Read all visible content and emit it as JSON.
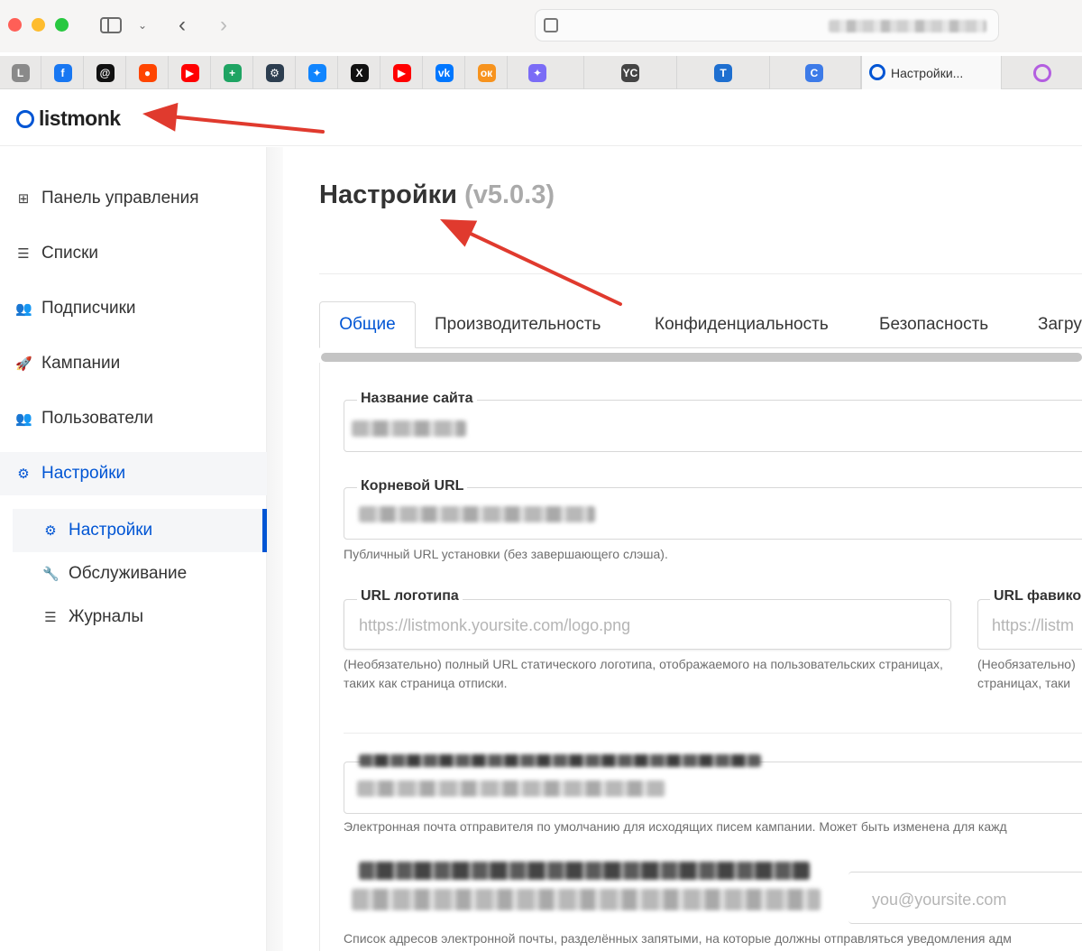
{
  "browser": {
    "active_tab_title": "Настройки...",
    "pinned_tabs": [
      {
        "icon": "l-icon",
        "glyph": "L",
        "color": "#8a8a8a"
      },
      {
        "icon": "facebook-icon",
        "glyph": "f",
        "color": "#1877f2"
      },
      {
        "icon": "threads-icon",
        "glyph": "@",
        "color": "#111111"
      },
      {
        "icon": "reddit-icon",
        "glyph": "●",
        "color": "#ff4500"
      },
      {
        "icon": "youtube-icon",
        "glyph": "▶",
        "color": "#ff0000"
      },
      {
        "icon": "sheets-icon",
        "glyph": "+",
        "color": "#1fa463"
      },
      {
        "icon": "gear-icon",
        "glyph": "⚙",
        "color": "#2d3e50"
      },
      {
        "icon": "bluesky-icon",
        "glyph": "✦",
        "color": "#1185fe"
      },
      {
        "icon": "x-icon",
        "glyph": "X",
        "color": "#111111"
      },
      {
        "icon": "youtube-icon",
        "glyph": "▶",
        "color": "#ff0000"
      },
      {
        "icon": "vk-icon",
        "glyph": "vk",
        "color": "#0077ff"
      },
      {
        "icon": "odnoklassniki-icon",
        "glyph": "ок",
        "color": "#f7931e"
      }
    ],
    "wide_tabs": [
      {
        "icon": "gemini-icon",
        "glyph": "✦",
        "color": "#7b6cf6"
      },
      {
        "icon": "yc-icon",
        "glyph": "YC",
        "color": "#444444"
      },
      {
        "icon": "t-icon",
        "glyph": "T",
        "color": "#1e6fd0"
      },
      {
        "icon": "c-icon",
        "glyph": "C",
        "color": "#3d7be8"
      }
    ]
  },
  "app": {
    "brand": "listmonk",
    "accent_color": "#0055d4"
  },
  "sidebar": {
    "items": [
      {
        "label": "Панель управления",
        "icon": "dashboard-icon"
      },
      {
        "label": "Списки",
        "icon": "list-icon"
      },
      {
        "label": "Подписчики",
        "icon": "users-icon"
      },
      {
        "label": "Кампании",
        "icon": "rocket-icon"
      },
      {
        "label": "Пользователи",
        "icon": "users-icon"
      },
      {
        "label": "Настройки",
        "icon": "gear-icon",
        "active": true
      }
    ],
    "subitems": [
      {
        "label": "Настройки",
        "icon": "gear-icon",
        "active": true
      },
      {
        "label": "Обслуживание",
        "icon": "wrench-icon"
      },
      {
        "label": "Журналы",
        "icon": "list-icon"
      }
    ]
  },
  "main": {
    "title": "Настройки",
    "version": "(v5.0.3)",
    "tabs": [
      {
        "label": "Общие",
        "active": true
      },
      {
        "label": "Производительность"
      },
      {
        "label": "Конфиденциальность"
      },
      {
        "label": "Безопасность"
      },
      {
        "label": "Загру"
      }
    ],
    "fields": {
      "site_name": {
        "label": "Название сайта"
      },
      "root_url": {
        "label": "Корневой URL",
        "help": "Публичный URL установки (без завершающего слэша)."
      },
      "logo_url": {
        "label": "URL логотипа",
        "placeholder": "https://listmonk.yoursite.com/logo.png",
        "help": "(Необязательно) полный URL статического логотипа, отображаемого на пользовательских страницах, таких как страница отписки."
      },
      "favicon_url": {
        "label": "URL фавико",
        "placeholder": "https://listm",
        "help_line1": "(Необязательно)",
        "help_line2": "страницах, таки"
      },
      "from_email": {
        "help": "Электронная почта отправителя по умолчанию для исходящих писем кампании. Может быть изменена для кажд"
      },
      "notify_emails": {
        "placeholder": "you@yoursite.com",
        "help": "Список адресов электронной почты, разделённых запятыми, на которые должны отправляться уведомления адм"
      }
    }
  },
  "annotations": {
    "arrow_color": "#e03a2e"
  }
}
